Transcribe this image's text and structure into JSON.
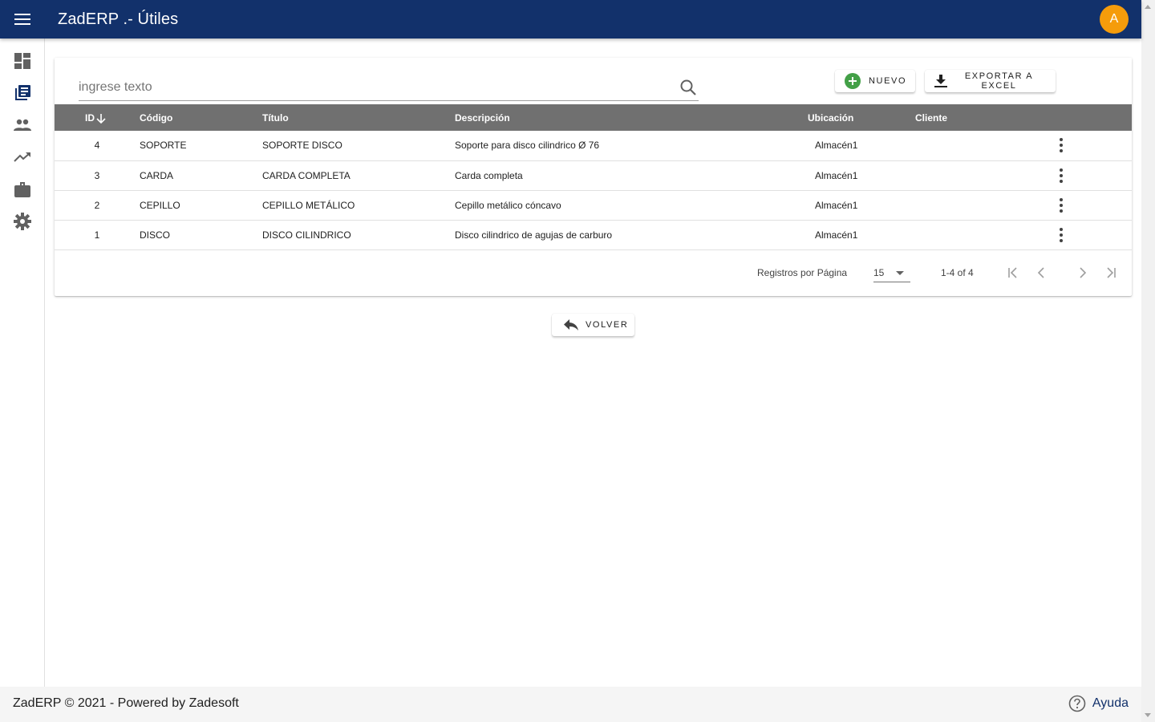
{
  "header": {
    "title": "ZadERP .- Útiles",
    "avatar_initial": "A"
  },
  "sidebar": {
    "items": [
      {
        "icon": "dashboard-icon"
      },
      {
        "icon": "library-books-icon",
        "active": true
      },
      {
        "icon": "people-icon"
      },
      {
        "icon": "trending-up-icon"
      },
      {
        "icon": "briefcase-icon"
      },
      {
        "icon": "gear-icon"
      }
    ]
  },
  "search": {
    "placeholder": "ingrese texto",
    "value": ""
  },
  "toolbar": {
    "new_label": "NUEVO",
    "export_label": "EXPORTAR A EXCEL"
  },
  "table": {
    "columns": {
      "id": "ID",
      "codigo": "Código",
      "titulo": "Título",
      "descripcion": "Descripción",
      "ubicacion": "Ubicación",
      "cliente": "Cliente"
    },
    "rows": [
      {
        "id": "4",
        "codigo": "SOPORTE",
        "titulo": "SOPORTE DISCO",
        "descripcion": "Soporte para disco cilindrico Ø 76",
        "ubicacion": "Almacén1",
        "cliente": ""
      },
      {
        "id": "3",
        "codigo": "CARDA",
        "titulo": "CARDA COMPLETA",
        "descripcion": "Carda completa",
        "ubicacion": "Almacén1",
        "cliente": ""
      },
      {
        "id": "2",
        "codigo": "CEPILLO",
        "titulo": "CEPILLO METÁLICO",
        "descripcion": "Cepillo metálico cóncavo",
        "ubicacion": "Almacén1",
        "cliente": ""
      },
      {
        "id": "1",
        "codigo": "DISCO",
        "titulo": "DISCO CILINDRICO",
        "descripcion": "Disco cilindrico de agujas de carburo",
        "ubicacion": "Almacén1",
        "cliente": ""
      }
    ]
  },
  "paginator": {
    "label": "Registros por Página",
    "page_size": "15",
    "range": "1-4 of 4"
  },
  "back_button": {
    "label": "VOLVER"
  },
  "footer": {
    "text": "ZadERP © 2021 - Powered by Zadesoft",
    "help_label": "Ayuda"
  },
  "colors": {
    "primary": "#12316b",
    "accent": "#f59c0b",
    "table_header": "#707070",
    "new_icon": "#43a047"
  }
}
